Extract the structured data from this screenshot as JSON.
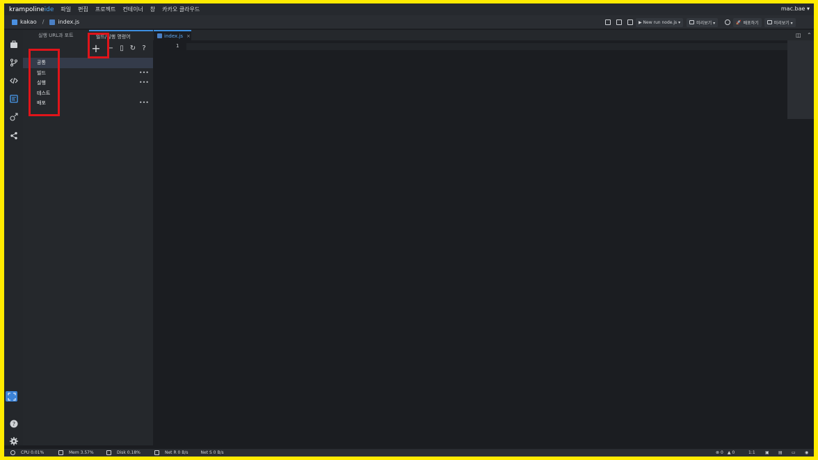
{
  "app": {
    "brand_main": "krampoline",
    "brand_accent": "ide",
    "user": "mac.bae ▾"
  },
  "menu": [
    "파일",
    "편집",
    "프로젝트",
    "컨테이너",
    "창",
    "카카오 클라우드"
  ],
  "breadcrumb": {
    "project": "kakao",
    "separator": "/",
    "file": "index.js"
  },
  "toolbar": {
    "run_label": "▶ New run node.js ▾",
    "preview_label": "미리보기 ▾",
    "deploy_label": "배포하기",
    "preview2_label": "미리보기 ▾"
  },
  "side_panel": {
    "tabs": [
      "실행 URL과 포트",
      "빌드/실행 명령어"
    ],
    "items": [
      {
        "label": "공통",
        "more": ""
      },
      {
        "label": "빌드",
        "more": "•••"
      },
      {
        "label": "실행",
        "more": "•••"
      },
      {
        "label": "테스트",
        "more": ""
      },
      {
        "label": "배포",
        "more": "•••"
      }
    ]
  },
  "editor": {
    "tab_label": "index.js",
    "tab_close": "×",
    "line_number": "1"
  },
  "status": {
    "cpu": "CPU 0.01%",
    "mem": "Mem 3.57%",
    "disk": "Disk 0.18%",
    "net_r": "Net R 0 B/s",
    "net_s": "Net S 0 B/s",
    "errors": "0",
    "warnings": "0",
    "position": "1:1"
  },
  "colors": {
    "accent": "#3d8fe0",
    "highlight": "#e0141a",
    "frame": "#ffeb00"
  }
}
